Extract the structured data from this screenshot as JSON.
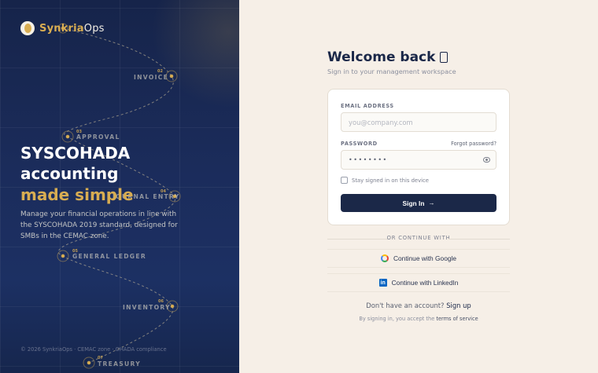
{
  "brand": {
    "name_primary": "Synkria",
    "name_secondary": "Ops"
  },
  "workflow": {
    "steps": [
      {
        "num": "02",
        "label": "INVOICE"
      },
      {
        "num": "03",
        "label": "APPROVAL"
      },
      {
        "num": "04",
        "label": "JOURNAL ENTRY"
      },
      {
        "num": "05",
        "label": "GENERAL LEDGER"
      },
      {
        "num": "06",
        "label": "INVENTORY"
      },
      {
        "num": "07",
        "label": "TREASURY"
      }
    ]
  },
  "hero": {
    "line1": "SYSCOHADA",
    "line2": "accounting",
    "accent": "made simple",
    "description": "Manage your financial operations in line with the SYSCOHADA 2019 standard, designed for SMBs in the CEMAC zone."
  },
  "footer": {
    "note": "© 2026 SynkriaOps · CEMAC zone · OHADA compliance"
  },
  "login": {
    "title": "Welcome back",
    "subtitle": "Sign in to your management workspace",
    "email_label": "EMAIL ADDRESS",
    "email_placeholder": "you@company.com",
    "password_label": "PASSWORD",
    "forgot_label": "Forgot password?",
    "password_value": "••••••••",
    "remember_label": "Stay signed in on this device",
    "submit_label": "Sign In",
    "divider_label": "OR CONTINUE WITH",
    "google_label": "Continue with Google",
    "linkedin_label": "Continue with LinkedIn",
    "signup_prompt": "Don't have an account?",
    "signup_link": "Sign up",
    "terms_prompt": "By signing in, you accept the",
    "terms_link": "terms of service"
  },
  "colors": {
    "navy": "#1b2848",
    "gold": "#d8ad52",
    "cream": "#f6efe7"
  },
  "icons": {
    "logo": "brand-logo-icon",
    "title": "door-icon",
    "eye": "eye-icon",
    "arrow": "arrow-right-icon",
    "google": "google-icon",
    "linkedin": "linkedin-icon"
  }
}
